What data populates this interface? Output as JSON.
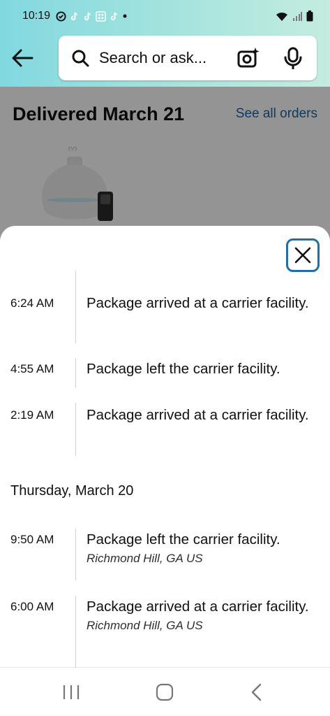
{
  "status_bar": {
    "time": "10:19",
    "notification_icons": [
      "app-icon",
      "tiktok-icon",
      "tiktok-icon",
      "qr-code-icon",
      "tiktok-icon"
    ],
    "right_icons": [
      "wifi-icon",
      "signal-icon",
      "battery-icon"
    ]
  },
  "search": {
    "placeholder": "Search or ask..."
  },
  "orders": {
    "delivered_title": "Delivered March 21",
    "see_all_label": "See all orders"
  },
  "tracking": {
    "events_top": [
      {
        "time": "6:24 AM",
        "description": "Package arrived at a carrier facility.",
        "location": ""
      },
      {
        "time": "4:55 AM",
        "description": "Package left the carrier facility.",
        "location": ""
      },
      {
        "time": "2:19 AM",
        "description": "Package arrived at a carrier facility.",
        "location": ""
      }
    ],
    "day_header": "Thursday, March 20",
    "events_bottom": [
      {
        "time": "9:50 AM",
        "description": "Package left the carrier facility.",
        "location": "Richmond Hill, GA US"
      },
      {
        "time": "6:00 AM",
        "description": "Package arrived at a carrier facility.",
        "location": "Richmond Hill, GA US"
      }
    ]
  },
  "colors": {
    "header_gradient_start": "#82d8e0",
    "header_gradient_end": "#c4ece0",
    "link": "#2162a1",
    "close_border": "#236ea5"
  },
  "nav_bar": [
    "recents-icon",
    "home-icon",
    "back-icon"
  ]
}
